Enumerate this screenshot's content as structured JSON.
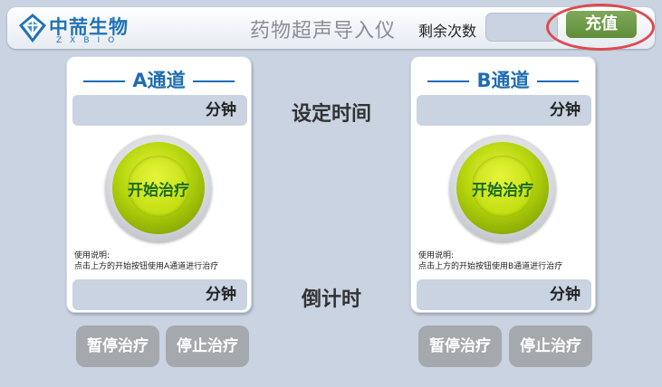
{
  "header": {
    "logo_cn": "中荋生物",
    "logo_en": "ZXBIO",
    "title": "药物超声导入仪",
    "remain_label": "剩余次数",
    "remain_value": "",
    "recharge_label": "充值"
  },
  "center": {
    "set_time_label": "设定时间",
    "countdown_label": "倒计时"
  },
  "channels": [
    {
      "title": "A通道",
      "time_value": "",
      "time_unit": "分钟",
      "start_label": "开始治疗",
      "instructions_title": "使用说明:",
      "instructions_text": "点击上方的开始按钮使用A通道进行治疗",
      "countdown_value": "",
      "countdown_unit": "分钟",
      "pause_label": "暂停治疗",
      "stop_label": "停止治疗"
    },
    {
      "title": "B通道",
      "time_value": "",
      "time_unit": "分钟",
      "start_label": "开始治疗",
      "instructions_title": "使用说明:",
      "instructions_text": "点击上方的开始按钮使用B通道进行治疗",
      "countdown_value": "",
      "countdown_unit": "分钟",
      "pause_label": "暂停治疗",
      "stop_label": "停止治疗"
    }
  ],
  "colors": {
    "background": "#c9d3e1",
    "brand_blue": "#1f6db3",
    "recharge_green": "#6a9a45",
    "highlight_red": "#dd4b4f",
    "start_green": "#b4d40c",
    "control_gray": "#a5a8ad"
  },
  "icons": {
    "logo": "zxbio-logo-icon"
  }
}
